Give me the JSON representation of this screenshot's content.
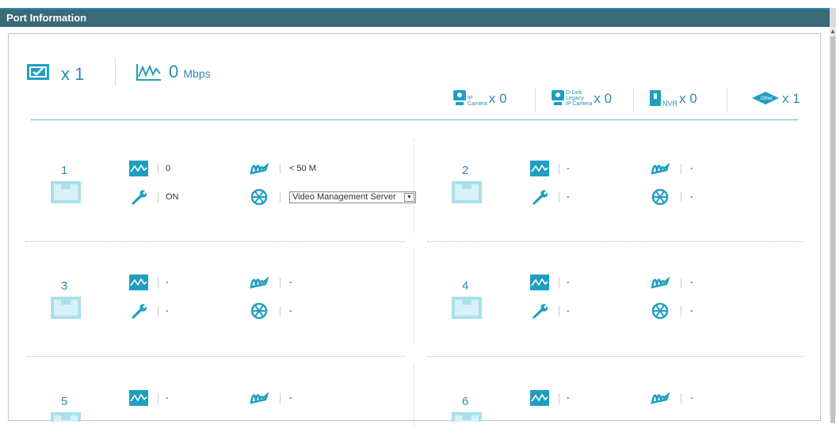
{
  "panel": {
    "title": "Port Information"
  },
  "summary": {
    "ports_active_count": "x 1",
    "bandwidth_value": "0",
    "bandwidth_unit": "Mbps"
  },
  "devices": [
    {
      "label": "IP\nCamera",
      "count": "x 0",
      "icon": "ip-camera-icon"
    },
    {
      "label": "D-Link\nLegacy\nIP Camera",
      "count": "x 0",
      "icon": "dlink-camera-icon"
    },
    {
      "label": "NVR",
      "count": "x 0",
      "icon": "nvr-icon"
    },
    {
      "label": "Other",
      "count": "x 1",
      "icon": "other-device-icon"
    }
  ],
  "ports": [
    {
      "number": "1",
      "traffic": "0",
      "power": "< 50 M",
      "status": "ON",
      "device": "Video Management Server"
    },
    {
      "number": "2",
      "traffic": "-",
      "power": "-",
      "status": "-",
      "device": "-"
    },
    {
      "number": "3",
      "traffic": "-",
      "power": "-",
      "status": "-",
      "device": "-"
    },
    {
      "number": "4",
      "traffic": "-",
      "power": "-",
      "status": "-",
      "device": "-"
    },
    {
      "number": "5",
      "traffic": "-",
      "power": "-",
      "status": "-",
      "device": "-"
    },
    {
      "number": "6",
      "traffic": "-",
      "power": "-",
      "status": "-",
      "device": "-"
    }
  ],
  "colors": {
    "accent": "#2d8bb0",
    "icon": "#18a3bd",
    "title_bg": "#3b6a78"
  }
}
